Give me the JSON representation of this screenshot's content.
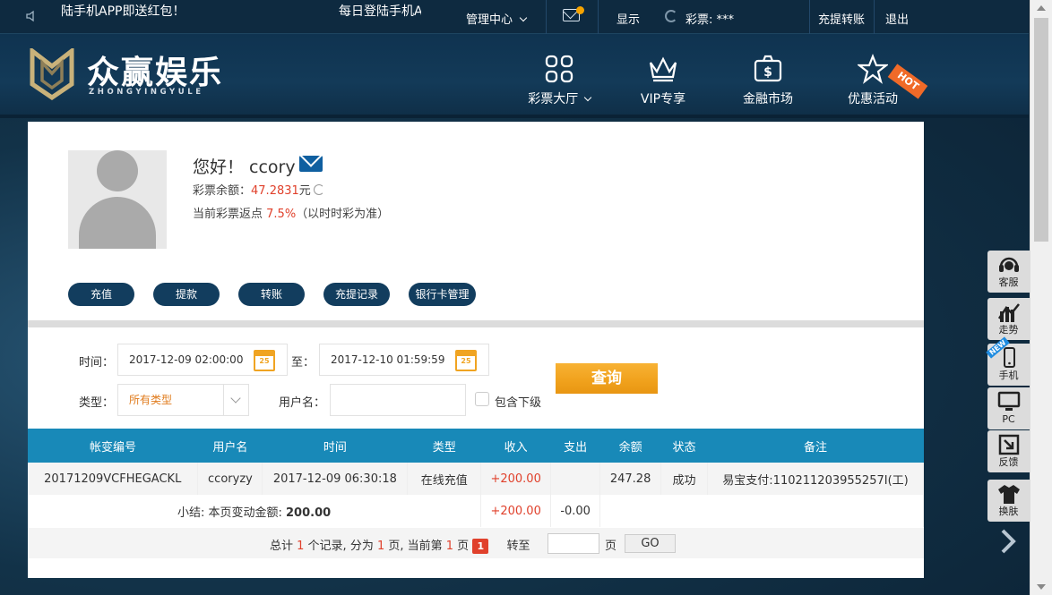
{
  "topbar": {
    "notice_1": "陆手机APP即送红包！",
    "notice_2": "每日登陆手机A",
    "manage_center": "管理中心",
    "display": "显示",
    "lottery_balance": "彩票: ***",
    "deposit_transfer": "充提转账",
    "logout": "退出"
  },
  "brand": {
    "name": "众赢娱乐",
    "subtitle": "ZHONGYINGYULE"
  },
  "nav": [
    {
      "label": "彩票大厅",
      "icon": "grid-icon"
    },
    {
      "label": "VIP专享",
      "icon": "crown-icon"
    },
    {
      "label": "金融市场",
      "icon": "money-bag-icon"
    },
    {
      "label": "优惠活动",
      "icon": "star-icon"
    }
  ],
  "hot_badge": "HOT",
  "profile": {
    "greeting": "您好！ ccory",
    "balance_label": "彩票余额：",
    "balance_value": "47.2831",
    "balance_unit": "元",
    "rebate_label": "当前彩票返点 ",
    "rebate_value": "7.5%",
    "rebate_note": "（以时时彩为准）"
  },
  "actions": [
    "充值",
    "提款",
    "转账",
    "充提记录",
    "银行卡管理"
  ],
  "filters": {
    "time_label": "时间：",
    "start_time": "2017-12-09 02:00:00",
    "to_label": "至：",
    "end_time": "2017-12-10 01:59:59",
    "calendar_day": "25",
    "type_label": "类型：",
    "type_value": "所有类型",
    "username_label": "用户名：",
    "username_value": "",
    "include_sub_label": "包含下级",
    "query_button": "查询"
  },
  "table": {
    "headers": [
      "帐变编号",
      "用户名",
      "时间",
      "类型",
      "收入",
      "支出",
      "余额",
      "状态",
      "备注"
    ],
    "rows": [
      [
        "20171209VCFHEGACKL",
        "ccoryzy",
        "2017-12-09 06:30:18",
        "在线充值",
        "+200.00",
        "",
        "247.28",
        "成功",
        "易宝支付:110211203955257I(工)"
      ]
    ],
    "subtotal_label": "小结: 本页变动金额: ",
    "subtotal_value": "200.00",
    "subtotal_income": "+200.00",
    "subtotal_expense": "-0.00"
  },
  "pager": {
    "t1": "总计 ",
    "records": "1",
    "t2": " 个记录, 分为 ",
    "pages": "1",
    "t3": " 页, 当前第 ",
    "current": "1",
    "t4": " 页 ",
    "current_box": "1",
    "goto_label": "转至",
    "page_unit": "页",
    "go_button": "GO"
  },
  "sidebar": [
    {
      "label": "客服",
      "icon": "headset-icon"
    },
    {
      "label": "走势",
      "icon": "trend-chart-icon"
    },
    {
      "label": "手机",
      "icon": "mobile-icon"
    },
    {
      "label": "PC",
      "icon": "monitor-icon"
    },
    {
      "label": "反馈",
      "icon": "feedback-icon"
    },
    {
      "label": "换肤",
      "icon": "shirt-icon"
    }
  ],
  "new_badge": "NEW"
}
